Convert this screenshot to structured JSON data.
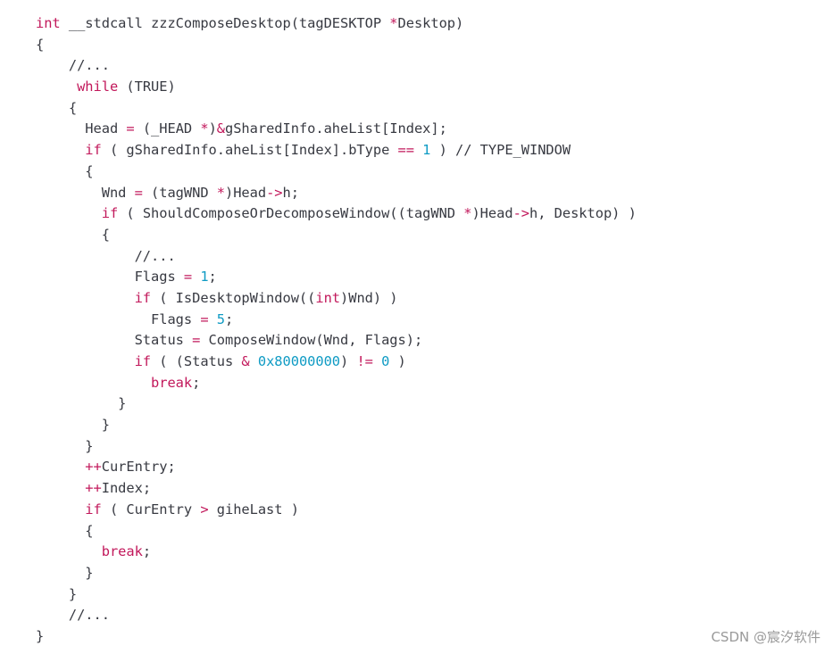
{
  "code_block": {
    "language": "c",
    "lines": [
      [
        {
          "t": "int",
          "c": "kw2"
        },
        {
          "t": " __stdcall zzzComposeDesktop(tagDESKTOP ",
          "c": ""
        },
        {
          "t": "*",
          "c": "op"
        },
        {
          "t": "Desktop)",
          "c": ""
        }
      ],
      [
        {
          "t": "{",
          "c": ""
        }
      ],
      [
        {
          "t": "    //...",
          "c": "cm"
        }
      ],
      [
        {
          "t": "     ",
          "c": ""
        },
        {
          "t": "while",
          "c": "kw2"
        },
        {
          "t": " (TRUE)",
          "c": ""
        }
      ],
      [
        {
          "t": "    {",
          "c": ""
        }
      ],
      [
        {
          "t": "      Head ",
          "c": ""
        },
        {
          "t": "=",
          "c": "op"
        },
        {
          "t": " (_HEAD ",
          "c": ""
        },
        {
          "t": "*",
          "c": "op"
        },
        {
          "t": ")",
          "c": ""
        },
        {
          "t": "&",
          "c": "op"
        },
        {
          "t": "gSharedInfo.aheList[Index];",
          "c": ""
        }
      ],
      [
        {
          "t": "      ",
          "c": ""
        },
        {
          "t": "if",
          "c": "kw2"
        },
        {
          "t": " ( gSharedInfo.aheList[Index].bType ",
          "c": ""
        },
        {
          "t": "==",
          "c": "op"
        },
        {
          "t": " ",
          "c": ""
        },
        {
          "t": "1",
          "c": "num"
        },
        {
          "t": " ) // TYPE_WINDOW",
          "c": ""
        }
      ],
      [
        {
          "t": "      {",
          "c": ""
        }
      ],
      [
        {
          "t": "        Wnd ",
          "c": ""
        },
        {
          "t": "=",
          "c": "op"
        },
        {
          "t": " (tagWND ",
          "c": ""
        },
        {
          "t": "*",
          "c": "op"
        },
        {
          "t": ")Head",
          "c": ""
        },
        {
          "t": "->",
          "c": "op"
        },
        {
          "t": "h;",
          "c": ""
        }
      ],
      [
        {
          "t": "        ",
          "c": ""
        },
        {
          "t": "if",
          "c": "kw2"
        },
        {
          "t": " ( ShouldComposeOrDecomposeWindow((tagWND ",
          "c": ""
        },
        {
          "t": "*",
          "c": "op"
        },
        {
          "t": ")Head",
          "c": ""
        },
        {
          "t": "->",
          "c": "op"
        },
        {
          "t": "h, Desktop) )",
          "c": ""
        }
      ],
      [
        {
          "t": "        {",
          "c": ""
        }
      ],
      [
        {
          "t": "            //...",
          "c": "cm"
        }
      ],
      [
        {
          "t": "            Flags ",
          "c": ""
        },
        {
          "t": "=",
          "c": "op"
        },
        {
          "t": " ",
          "c": ""
        },
        {
          "t": "1",
          "c": "num"
        },
        {
          "t": ";",
          "c": ""
        }
      ],
      [
        {
          "t": "            ",
          "c": ""
        },
        {
          "t": "if",
          "c": "kw2"
        },
        {
          "t": " ( IsDesktopWindow((",
          "c": ""
        },
        {
          "t": "int",
          "c": "kw2"
        },
        {
          "t": ")Wnd) )",
          "c": ""
        }
      ],
      [
        {
          "t": "              Flags ",
          "c": ""
        },
        {
          "t": "=",
          "c": "op"
        },
        {
          "t": " ",
          "c": ""
        },
        {
          "t": "5",
          "c": "num"
        },
        {
          "t": ";",
          "c": ""
        }
      ],
      [
        {
          "t": "            Status ",
          "c": ""
        },
        {
          "t": "=",
          "c": "op"
        },
        {
          "t": " ComposeWindow(Wnd, Flags);",
          "c": ""
        }
      ],
      [
        {
          "t": "            ",
          "c": ""
        },
        {
          "t": "if",
          "c": "kw2"
        },
        {
          "t": " ( (Status ",
          "c": ""
        },
        {
          "t": "&",
          "c": "op"
        },
        {
          "t": " ",
          "c": ""
        },
        {
          "t": "0x80000000",
          "c": "num"
        },
        {
          "t": ") ",
          "c": ""
        },
        {
          "t": "!=",
          "c": "op"
        },
        {
          "t": " ",
          "c": ""
        },
        {
          "t": "0",
          "c": "num"
        },
        {
          "t": " )",
          "c": ""
        }
      ],
      [
        {
          "t": "              ",
          "c": ""
        },
        {
          "t": "break",
          "c": "kw2"
        },
        {
          "t": ";",
          "c": ""
        }
      ],
      [
        {
          "t": "          }",
          "c": ""
        }
      ],
      [
        {
          "t": "        }",
          "c": ""
        }
      ],
      [
        {
          "t": "      }",
          "c": ""
        }
      ],
      [
        {
          "t": "      ",
          "c": ""
        },
        {
          "t": "++",
          "c": "op"
        },
        {
          "t": "CurEntry;",
          "c": ""
        }
      ],
      [
        {
          "t": "      ",
          "c": ""
        },
        {
          "t": "++",
          "c": "op"
        },
        {
          "t": "Index;",
          "c": ""
        }
      ],
      [
        {
          "t": "      ",
          "c": ""
        },
        {
          "t": "if",
          "c": "kw2"
        },
        {
          "t": " ( CurEntry ",
          "c": ""
        },
        {
          "t": ">",
          "c": "op"
        },
        {
          "t": " giheLast )",
          "c": ""
        }
      ],
      [
        {
          "t": "      {",
          "c": ""
        }
      ],
      [
        {
          "t": "        ",
          "c": ""
        },
        {
          "t": "break",
          "c": "kw2"
        },
        {
          "t": ";",
          "c": ""
        }
      ],
      [
        {
          "t": "      }",
          "c": ""
        }
      ],
      [
        {
          "t": "    }",
          "c": ""
        }
      ],
      [
        {
          "t": "    //...",
          "c": "cm"
        }
      ],
      [
        {
          "t": "}",
          "c": ""
        }
      ]
    ]
  },
  "watermark": "CSDN @宸汐软件",
  "colors": {
    "keyword": "#c2185b",
    "number": "#0f9bc4",
    "text": "#383a42",
    "watermark": "#9a9a9a"
  }
}
